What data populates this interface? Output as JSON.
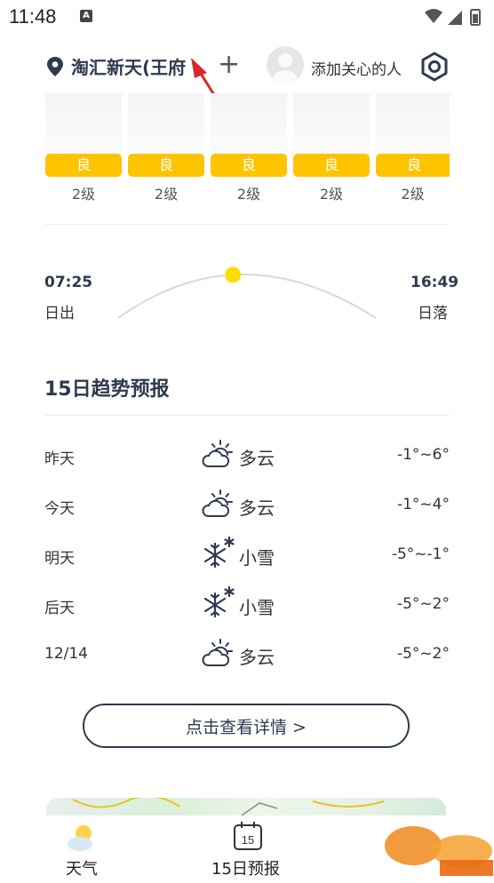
{
  "status_bar": {
    "time": "11:48",
    "notification_badge": "A"
  },
  "header": {
    "location": "淘汇新天(王府",
    "add_label": "+",
    "care_label": "添加关心的人"
  },
  "aqi": [
    {
      "badge": "良",
      "level": "2级"
    },
    {
      "badge": "良",
      "level": "2级"
    },
    {
      "badge": "良",
      "level": "2级"
    },
    {
      "badge": "良",
      "level": "2级"
    },
    {
      "badge": "良",
      "level": "2级"
    }
  ],
  "sun": {
    "sunrise_time": "07:25",
    "sunrise_label": "日出",
    "sunset_time": "16:49",
    "sunset_label": "日落",
    "progress": 0.45
  },
  "forecast": {
    "title": "15日趋势预报",
    "rows": [
      {
        "day": "昨天",
        "icon": "partly-cloudy-icon",
        "desc": "多云",
        "temp": "-1°~6°"
      },
      {
        "day": "今天",
        "icon": "partly-cloudy-icon",
        "desc": "多云",
        "temp": "-1°~4°"
      },
      {
        "day": "明天",
        "icon": "snow-icon",
        "desc": "小雪",
        "temp": "-5°~-1°"
      },
      {
        "day": "后天",
        "icon": "snow-icon",
        "desc": "小雪",
        "temp": "-5°~2°"
      },
      {
        "day": "12/14",
        "icon": "partly-cloudy-icon",
        "desc": "多云",
        "temp": "-5°~2°"
      }
    ],
    "details_button": "点击查看详情 >"
  },
  "nav": {
    "weather_label": "天气",
    "forecast_label": "15日预报",
    "forecast_icon_number": "15"
  },
  "colors": {
    "accent": "#ffc400",
    "text": "#2d3a4f",
    "sun": "#ffdd00"
  }
}
